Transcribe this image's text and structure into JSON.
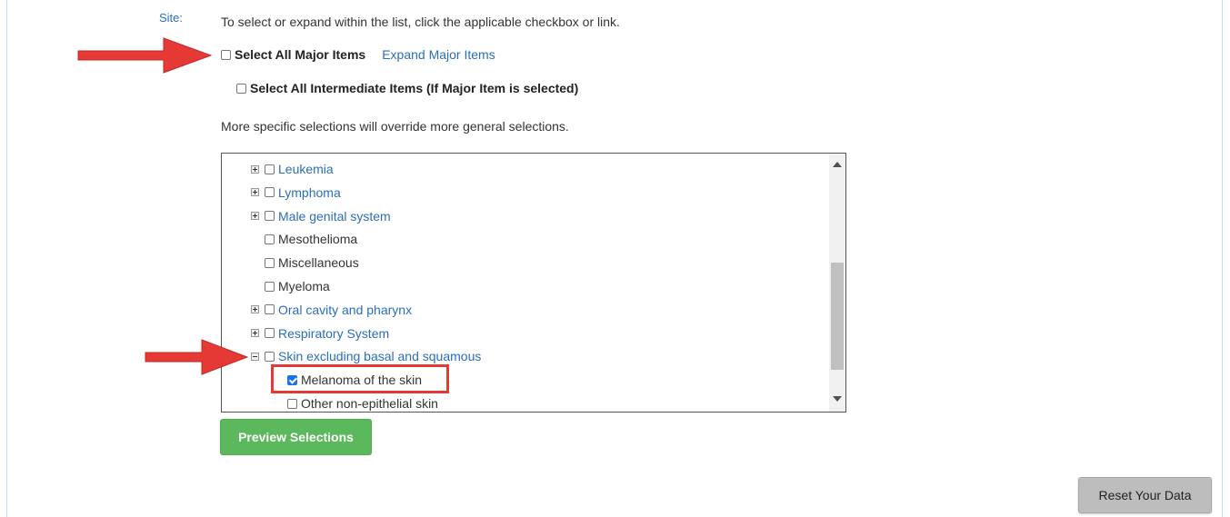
{
  "site_label": "Site:",
  "instructions": "To select or expand within the list, click the applicable checkbox or link.",
  "major": {
    "select_all_label": "Select All Major Items",
    "expand_link": "Expand Major Items",
    "checked": false
  },
  "intermediate": {
    "select_all_label": "Select All Intermediate Items (If Major Item is selected)",
    "checked": false
  },
  "override_note": "More specific selections will override more general selections.",
  "site_list": {
    "items": [
      {
        "label": "Leukemia",
        "expandable": true,
        "expanded": false,
        "checked": false,
        "level": 0
      },
      {
        "label": "Lymphoma",
        "expandable": true,
        "expanded": false,
        "checked": false,
        "level": 0
      },
      {
        "label": "Male genital system",
        "expandable": true,
        "expanded": false,
        "checked": false,
        "level": 0
      },
      {
        "label": "Mesothelioma",
        "expandable": false,
        "expanded": false,
        "checked": false,
        "level": 0
      },
      {
        "label": "Miscellaneous",
        "expandable": false,
        "expanded": false,
        "checked": false,
        "level": 0
      },
      {
        "label": "Myeloma",
        "expandable": false,
        "expanded": false,
        "checked": false,
        "level": 0
      },
      {
        "label": "Oral cavity and pharynx",
        "expandable": true,
        "expanded": false,
        "checked": false,
        "level": 0
      },
      {
        "label": "Respiratory System",
        "expandable": true,
        "expanded": false,
        "checked": false,
        "level": 0
      },
      {
        "label": "Skin excluding basal and squamous",
        "expandable": true,
        "expanded": true,
        "checked": false,
        "level": 0
      },
      {
        "label": "Melanoma of the skin",
        "expandable": false,
        "expanded": false,
        "checked": true,
        "level": 1
      },
      {
        "label": "Other non-epithelial skin",
        "expandable": false,
        "expanded": false,
        "checked": false,
        "level": 1
      }
    ],
    "scroll_position": 0.55
  },
  "buttons": {
    "preview": "Preview Selections",
    "reset": "Reset Your Data"
  },
  "colors": {
    "link": "#2a6ebb",
    "preview_button": "#5cb85c",
    "reset_button": "#bdbdbd",
    "annotation": "#e53935"
  },
  "icons": {
    "expand": "plus-box-icon",
    "collapse": "minus-box-icon",
    "annotation_arrow": "red-arrow-icon"
  }
}
